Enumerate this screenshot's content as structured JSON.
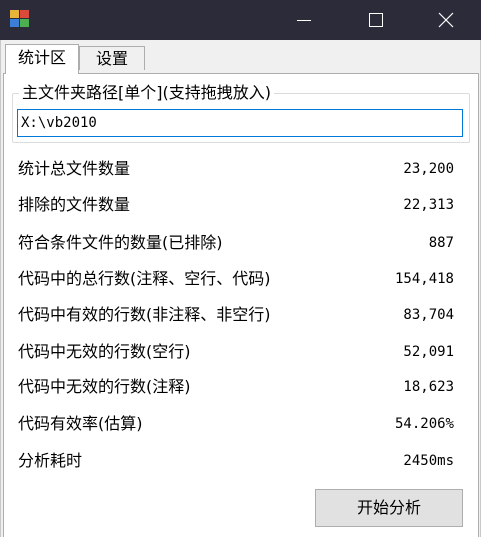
{
  "window": {
    "minimize_glyph": "—",
    "maximize_glyph": "☐",
    "close_glyph": "✕",
    "titlebar_color": "#2b2b3a"
  },
  "tabs": [
    {
      "label": "统计区",
      "selected": true
    },
    {
      "label": "设置",
      "selected": false
    }
  ],
  "path_group": {
    "legend": "主文件夹路径[单个](支持拖拽放入)",
    "value": "X:\\vb2010"
  },
  "stats": [
    {
      "label": "统计总文件数量",
      "value": "23,200"
    },
    {
      "label": "排除的文件数量",
      "value": "22,313"
    },
    {
      "label": "符合条件文件的数量(已排除)",
      "value": "887"
    },
    {
      "label": "代码中的总行数(注释、空行、代码)",
      "value": "154,418"
    },
    {
      "label": "代码中有效的行数(非注释、非空行)",
      "value": "83,704"
    },
    {
      "label": "代码中无效的行数(空行)",
      "value": "52,091"
    },
    {
      "label": "代码中无效的行数(注释)",
      "value": "18,623"
    },
    {
      "label": "代码有效率(估算)",
      "value": "54.206%"
    },
    {
      "label": "分析耗时",
      "value": "2450ms"
    }
  ],
  "start_button": {
    "label": "开始分析"
  },
  "icons": {
    "app": "app-icon",
    "minimize": "minimize-icon",
    "maximize": "maximize-icon",
    "close": "close-icon"
  },
  "colors": {
    "accent": "#0078d7",
    "button_bg": "#e1e1e1"
  }
}
